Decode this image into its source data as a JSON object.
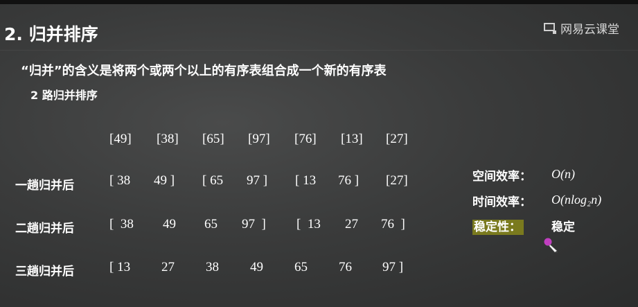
{
  "title": "2. 归并排序",
  "brand": {
    "name": "网易云课堂",
    "icon": "chalkboard-logo-icon"
  },
  "definition": "“归并”的含义是将两个或两个以上的有序表组合成一个新的有序表",
  "variant": "2 路归并排序",
  "initial": [
    "[49]",
    "[38]",
    "[65]",
    "[97]",
    "[76]",
    "[13]",
    "[27]"
  ],
  "passes": [
    {
      "label": "一趟归并后",
      "cells": [
        "[ 38",
        "49 ]",
        "[ 65",
        "97 ]",
        "[ 13",
        "76 ]",
        "[27]"
      ]
    },
    {
      "label": "二趟归并后",
      "cells": [
        "[  38",
        "49",
        "65",
        "97  ]",
        "[  13",
        "27",
        "76  ]"
      ]
    },
    {
      "label": "三趟归并后",
      "cells": [
        "[ 13",
        "27",
        "38",
        "49",
        "65",
        "76",
        "97 ]"
      ]
    }
  ],
  "info": [
    {
      "label": "空间效率：",
      "value": "O(n)"
    },
    {
      "label": "时间效率：",
      "value": "O(nlog₂n)"
    },
    {
      "label": "稳定性：",
      "value": "稳定"
    }
  ],
  "colors": {
    "highlight": "#7a7a1e",
    "cursor": "#c03fc0"
  }
}
